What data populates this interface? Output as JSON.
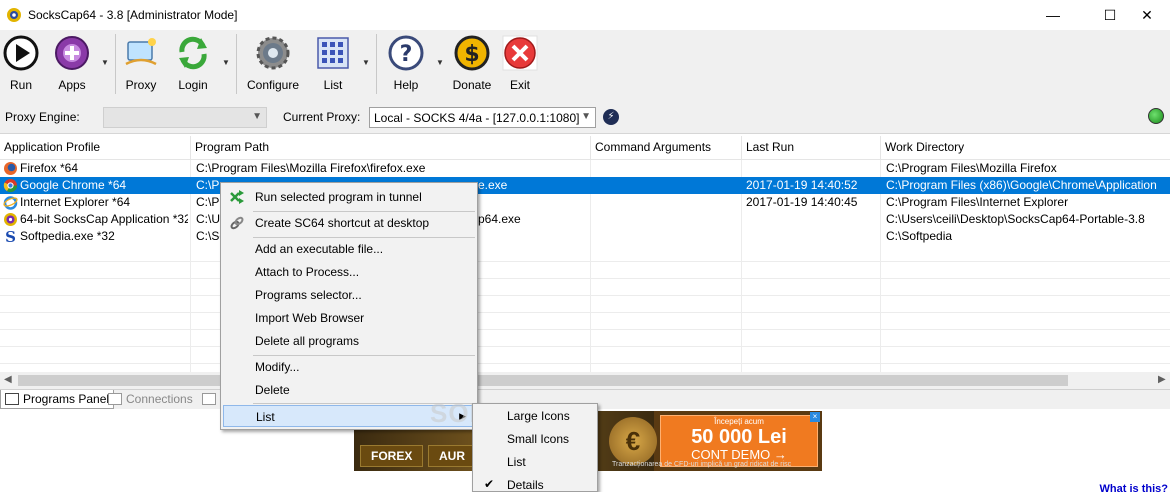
{
  "window": {
    "title": "SocksCap64 - 3.8 [Administrator Mode]",
    "controls": {
      "minimize": "—",
      "maximize": "☐",
      "close": "✕"
    }
  },
  "toolbar": {
    "buttons": [
      {
        "label": "Run",
        "icon": "play-icon"
      },
      {
        "label": "Apps",
        "icon": "add-app-icon"
      },
      {
        "label": "Proxy",
        "icon": "proxy-icon"
      },
      {
        "label": "Login",
        "icon": "login-refresh-icon"
      },
      {
        "label": "Configure",
        "icon": "gear-icon"
      },
      {
        "label": "List",
        "icon": "list-grid-icon"
      },
      {
        "label": "Help",
        "icon": "help-icon"
      },
      {
        "label": "Donate",
        "icon": "dollar-icon"
      },
      {
        "label": "Exit",
        "icon": "exit-icon"
      }
    ]
  },
  "proxybar": {
    "engine_label": "Proxy Engine:",
    "engine_value": "",
    "current_label": "Current Proxy:",
    "current_value": "Local - SOCKS 4/4a - [127.0.0.1:1080]"
  },
  "table": {
    "columns": [
      "Application Profile",
      "Program Path",
      "Command Arguments",
      "Last Run",
      "Work Directory"
    ],
    "rows": [
      {
        "name": "Firefox *64",
        "path": "C:\\Program Files\\Mozilla Firefox\\firefox.exe",
        "args": "",
        "last_run": "",
        "work_dir": "C:\\Program Files\\Mozilla Firefox",
        "icon": "firefox-icon"
      },
      {
        "name": "Google Chrome *64",
        "path": "C:\\Program Files (x86)\\Google\\Chrome\\Application\\chrome.exe",
        "args": "",
        "last_run": "2017-01-19 14:40:52",
        "work_dir": "C:\\Program Files (x86)\\Google\\Chrome\\Application",
        "icon": "chrome-icon"
      },
      {
        "name": "Internet Explorer *64",
        "path": "C:\\Program Files\\Internet Explorer\\iexplore.exe",
        "args": "",
        "last_run": "2017-01-19 14:40:45",
        "work_dir": "C:\\Program Files\\Internet Explorer",
        "icon": "ie-icon"
      },
      {
        "name": "64-bit SocksCap Application *32",
        "path": "C:\\Users\\ceili\\Desktop\\SocksCap64-Portable-3.8\\SocksCap64.exe",
        "args": "",
        "last_run": "",
        "work_dir": "C:\\Users\\ceili\\Desktop\\SocksCap64-Portable-3.8",
        "icon": "sockscap-icon"
      },
      {
        "name": "Softpedia.exe *32",
        "path": "C:\\Softpedia\\Softpedia.exe",
        "args": "",
        "last_run": "",
        "work_dir": "C:\\Softpedia",
        "icon": "softpedia-icon"
      }
    ],
    "visible_path": {
      "r0": "C:\\Program Files\\Mozilla Firefox\\firefox.exe",
      "r1a": "C:\\Pr",
      "r1b": "e.exe",
      "r2a": "C:\\Pr",
      "r3a": "C:\\Us",
      "r3b": "p64.exe",
      "r4a": "C:\\So"
    }
  },
  "tabs": {
    "programs": "Programs Panel",
    "connections": "Connections"
  },
  "context_menu": {
    "items": [
      "Run selected program in tunnel",
      "Create SC64 shortcut at desktop",
      "Add an executable file...",
      "Attach to Process...",
      "Programs selector...",
      "Import Web Browser",
      "Delete all programs",
      "Modify...",
      "Delete",
      "List"
    ],
    "submenu": [
      "Large Icons",
      "Small Icons",
      "List",
      "Details"
    ]
  },
  "ad": {
    "top": "Începeți acum",
    "amount": "50 000 Lei",
    "demo": "CONT DEMO →",
    "btn1": "FOREX",
    "btn2": "AUR",
    "fine": "Tranzacționarea de CFD-uri implică un grad ridicat de risc",
    "coin": "€"
  },
  "watermark": "SOFTPEDIA",
  "footer_link": "What is this?",
  "colors": {
    "selection": "#0078d7",
    "menu_hover": "#d7e8fb",
    "link": "#0000cc"
  }
}
